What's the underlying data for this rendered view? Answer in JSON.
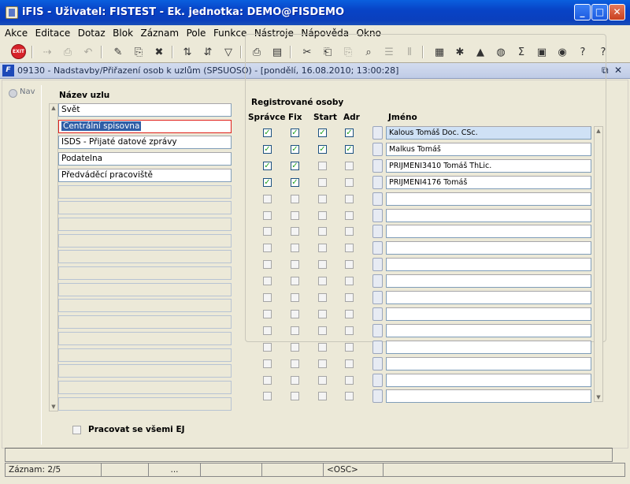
{
  "window": {
    "title": "iFIS - Uživatel: FISTEST - Ek. jednotka: DEMO@FISDEMO",
    "min_glyph": "_",
    "max_glyph": "□",
    "close_glyph": "✕"
  },
  "menu": [
    "Akce",
    "Editace",
    "Dotaz",
    "Blok",
    "Záznam",
    "Pole",
    "Funkce",
    "Nástroje",
    "Nápověda",
    "Okno"
  ],
  "toolbar": {
    "exit_label": "EXIT"
  },
  "form": {
    "title": "09130 - Nadstavby/Přiřazení osob k uzlům (SPSUOSO) - [pondělí, 16.08.2010; 13:00:28]",
    "restore_glyph": "⧉",
    "close_glyph": "✕",
    "nav_label": "Nav"
  },
  "nodes": {
    "header": "Název uzlu",
    "items": [
      "Svět",
      "Centrální spisovna",
      "ISDS - Přijaté datové zprávy",
      "Podatelna",
      "Předváděcí pracoviště",
      "",
      "",
      "",
      "",
      "",
      "",
      "",
      "",
      "",
      "",
      "",
      "",
      "",
      ""
    ],
    "selected_index": 1
  },
  "persons": {
    "group_title": "Registrované osoby",
    "columns": {
      "spravce": "Správce",
      "fix": "Fix",
      "start": "Start",
      "adr": "Adr",
      "name": "Jméno"
    },
    "rows": [
      {
        "name": "Kalous Tomáš Doc. CSc.",
        "spravce": true,
        "fix": true,
        "start": true,
        "adr": true
      },
      {
        "name": "Malkus Tomáš",
        "spravce": true,
        "fix": true,
        "start": true,
        "adr": true
      },
      {
        "name": "PRIJMENI3410 Tomáš ThLic.",
        "spravce": true,
        "fix": true,
        "start": false,
        "adr": false
      },
      {
        "name": "PRIJMENI4176 Tomáš",
        "spravce": true,
        "fix": true,
        "start": false,
        "adr": false
      },
      {
        "name": "",
        "spravce": false,
        "fix": false,
        "start": false,
        "adr": false
      },
      {
        "name": "",
        "spravce": false,
        "fix": false,
        "start": false,
        "adr": false
      },
      {
        "name": "",
        "spravce": false,
        "fix": false,
        "start": false,
        "adr": false
      },
      {
        "name": "",
        "spravce": false,
        "fix": false,
        "start": false,
        "adr": false
      },
      {
        "name": "",
        "spravce": false,
        "fix": false,
        "start": false,
        "adr": false
      },
      {
        "name": "",
        "spravce": false,
        "fix": false,
        "start": false,
        "adr": false
      },
      {
        "name": "",
        "spravce": false,
        "fix": false,
        "start": false,
        "adr": false
      },
      {
        "name": "",
        "spravce": false,
        "fix": false,
        "start": false,
        "adr": false
      },
      {
        "name": "",
        "spravce": false,
        "fix": false,
        "start": false,
        "adr": false
      },
      {
        "name": "",
        "spravce": false,
        "fix": false,
        "start": false,
        "adr": false
      },
      {
        "name": "",
        "spravce": false,
        "fix": false,
        "start": false,
        "adr": false
      },
      {
        "name": "",
        "spravce": false,
        "fix": false,
        "start": false,
        "adr": false
      },
      {
        "name": "",
        "spravce": false,
        "fix": false,
        "start": false,
        "adr": false
      }
    ]
  },
  "options": {
    "all_units_label": "Pracovat se všemi EJ",
    "all_units_checked": false
  },
  "status": {
    "record": "Záznam: 2/5",
    "ellipsis": "...",
    "osc": "<OSC>"
  }
}
